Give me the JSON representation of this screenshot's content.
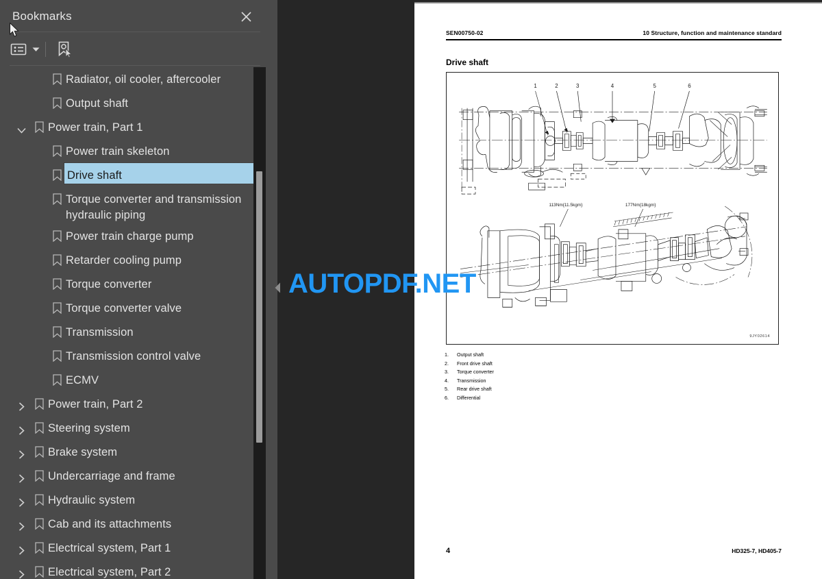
{
  "panel": {
    "title": "Bookmarks",
    "close_icon": "close-icon",
    "toolbar": {
      "list_options_icon": "list-options-icon",
      "caret_icon": "chevron-down-icon",
      "new-bookmark_icon": "bookmark-cursor-icon"
    }
  },
  "bookmarks": [
    {
      "label": "Radiator, oil cooler, aftercooler",
      "depth": 2,
      "twisty": "none",
      "selected": false
    },
    {
      "label": "Output shaft",
      "depth": 2,
      "twisty": "none",
      "selected": false
    },
    {
      "label": "Power train, Part 1",
      "depth": 1,
      "twisty": "expanded",
      "selected": false
    },
    {
      "label": "Power train skeleton",
      "depth": 2,
      "twisty": "none",
      "selected": false
    },
    {
      "label": "Drive shaft",
      "depth": 2,
      "twisty": "none",
      "selected": true
    },
    {
      "label": "Torque converter and transmission hydraulic piping",
      "depth": 2,
      "twisty": "none",
      "selected": false
    },
    {
      "label": "Power train charge pump",
      "depth": 2,
      "twisty": "none",
      "selected": false
    },
    {
      "label": "Retarder cooling pump",
      "depth": 2,
      "twisty": "none",
      "selected": false
    },
    {
      "label": "Torque converter",
      "depth": 2,
      "twisty": "none",
      "selected": false
    },
    {
      "label": "Torque converter valve",
      "depth": 2,
      "twisty": "none",
      "selected": false
    },
    {
      "label": "Transmission",
      "depth": 2,
      "twisty": "none",
      "selected": false
    },
    {
      "label": "Transmission control valve",
      "depth": 2,
      "twisty": "none",
      "selected": false
    },
    {
      "label": "ECMV",
      "depth": 2,
      "twisty": "none",
      "selected": false
    },
    {
      "label": "Power train, Part 2",
      "depth": 1,
      "twisty": "collapsed",
      "selected": false
    },
    {
      "label": "Steering system",
      "depth": 1,
      "twisty": "collapsed",
      "selected": false
    },
    {
      "label": "Brake system",
      "depth": 1,
      "twisty": "collapsed",
      "selected": false
    },
    {
      "label": "Undercarriage and frame",
      "depth": 1,
      "twisty": "collapsed",
      "selected": false
    },
    {
      "label": "Hydraulic system",
      "depth": 1,
      "twisty": "collapsed",
      "selected": false
    },
    {
      "label": "Cab and its attachments",
      "depth": 1,
      "twisty": "collapsed",
      "selected": false
    },
    {
      "label": "Electrical system, Part 1",
      "depth": 1,
      "twisty": "collapsed",
      "selected": false
    },
    {
      "label": "Electrical system, Part 2",
      "depth": 1,
      "twisty": "collapsed",
      "selected": false
    }
  ],
  "watermark": {
    "text": "AUTOPDF.NET",
    "color": "#2196f3"
  },
  "document": {
    "header_left": "SEN00750-02",
    "header_right": "10 Structure, function and maintenance standard",
    "title": "Drive shaft",
    "figure_code": "9JY02614",
    "torque_labels": [
      "113Nm{11.5kgm}",
      "177Nm{18kgm}"
    ],
    "callouts": [
      "1",
      "2",
      "3",
      "4",
      "5",
      "6"
    ],
    "legend": [
      {
        "num": "1.",
        "text": "Output shaft"
      },
      {
        "num": "2.",
        "text": "Front drive shaft"
      },
      {
        "num": "3.",
        "text": "Torque converter"
      },
      {
        "num": "4.",
        "text": "Transmission"
      },
      {
        "num": "5.",
        "text": "Rear drive shaft"
      },
      {
        "num": "6.",
        "text": "Differential"
      }
    ],
    "footer_page": "4",
    "footer_model": "HD325-7, HD405-7"
  },
  "colors": {
    "panel_bg": "#4a4a4a",
    "gutter_bg": "#262626",
    "selection": "#a6d2ea",
    "accent": "#2196f3"
  }
}
